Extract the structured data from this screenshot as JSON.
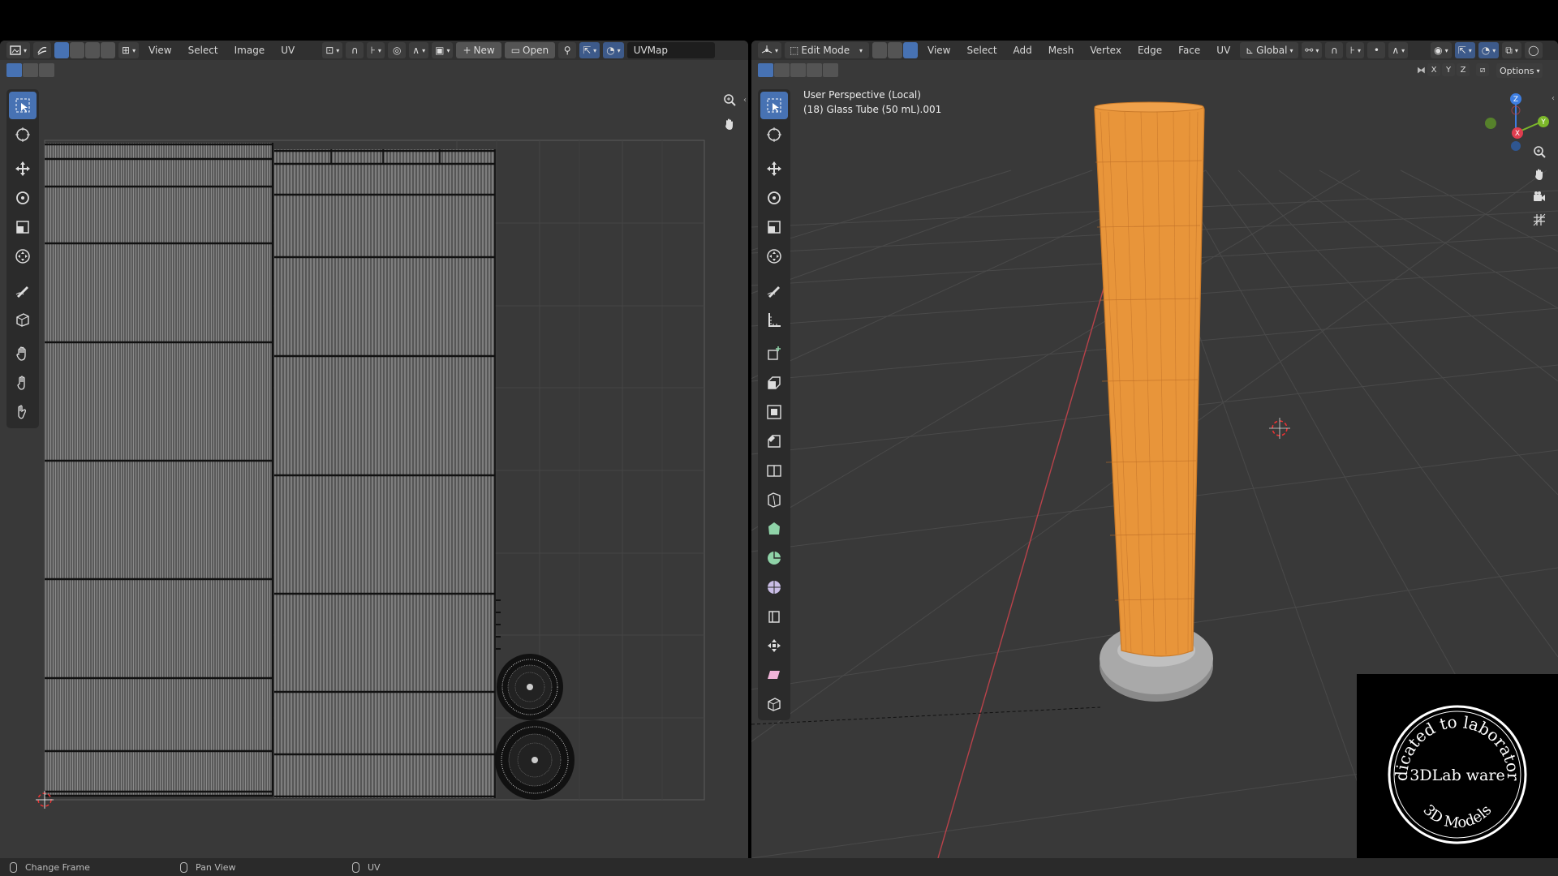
{
  "uv_editor": {
    "menus": [
      "View",
      "Select",
      "Image",
      "UV"
    ],
    "new_label": "New",
    "open_label": "Open",
    "uv_map": "UVMap"
  },
  "viewport": {
    "mode": "Edit Mode",
    "menus": [
      "View",
      "Select",
      "Add",
      "Mesh",
      "Vertex",
      "Edge",
      "Face",
      "UV"
    ],
    "orientation": "Global",
    "options_label": "Options",
    "axes": [
      "X",
      "Y",
      "Z"
    ],
    "perspective_label": "User Perspective (Local)",
    "object_label": "(18) Glass Tube (50 mL).001",
    "object_color": "#e8953a"
  },
  "statusbar": {
    "item1": "Change Frame",
    "item2": "Pan View",
    "item3": "UV"
  },
  "watermark": {
    "top_arc": "Dedicated to laboratories",
    "center": "3DLab ware",
    "bottom_arc": "3D Models"
  }
}
